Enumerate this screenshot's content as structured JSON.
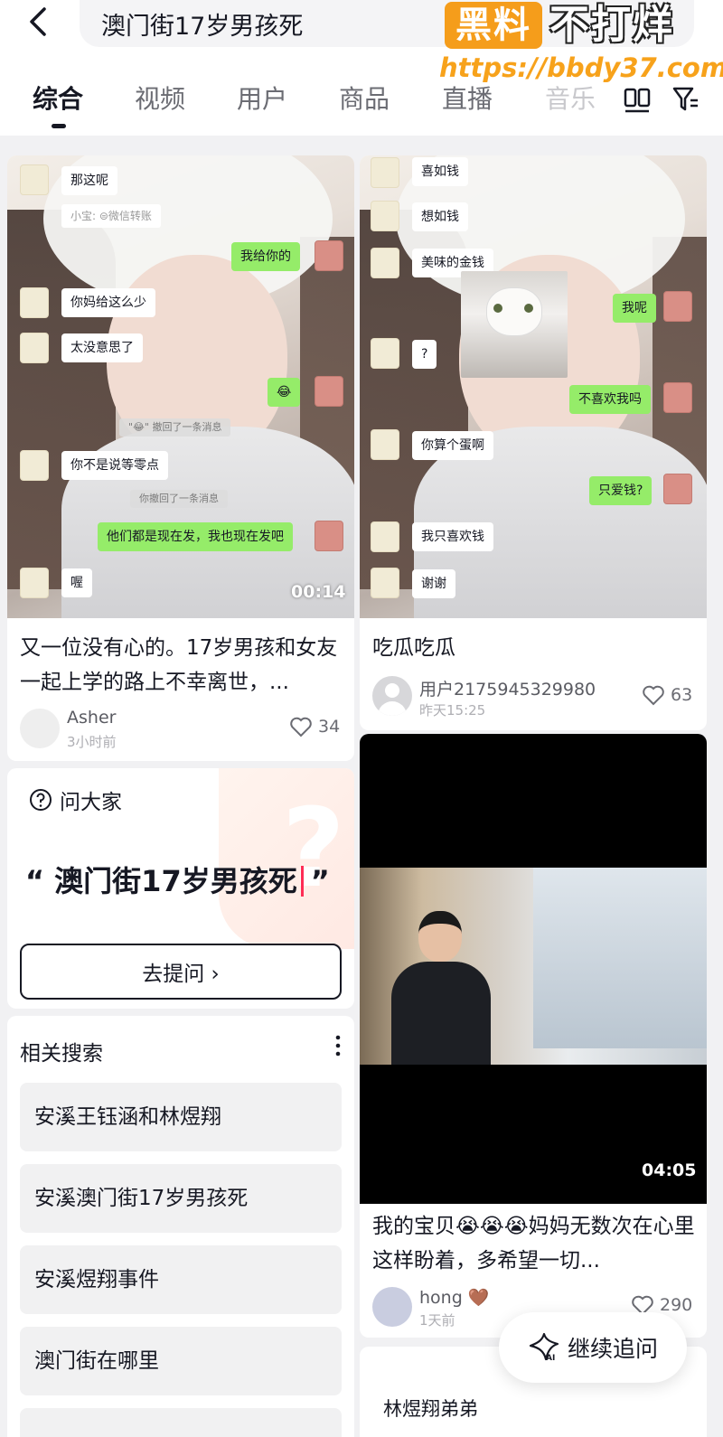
{
  "search": {
    "query": "澳门街17岁男孩死"
  },
  "watermark": {
    "brand_a": "黑料",
    "brand_b": "不打烊",
    "url": "https://bbdy37.com"
  },
  "tabs": [
    {
      "label": "综合"
    },
    {
      "label": "视频"
    },
    {
      "label": "用户"
    },
    {
      "label": "商品"
    },
    {
      "label": "直播"
    },
    {
      "label": "音乐"
    }
  ],
  "cards": {
    "first": {
      "duration": "00:14",
      "chat": {
        "m1": "那这呢",
        "transfer": "小宝: ⊜微信转账",
        "m2": "我给你的",
        "m3": "你妈给这么少",
        "m4": "太没意思了",
        "m5": "😂",
        "sys1": "\"😂\" 撤回了一条消息",
        "m6": "你不是说等零点",
        "sys2": "你撤回了一条消息",
        "m7": "他们都是现在发，我也现在发吧",
        "m8": "喔"
      },
      "title": "又一位没有心的。17岁男孩和女友一起上学的路上不幸离世，...",
      "author": "Asher",
      "time": "3小时前",
      "likes": "34"
    },
    "second": {
      "chat": {
        "m1": "喜如钱",
        "m2": "想如钱",
        "m3": "美味的金钱",
        "m4": "我呢",
        "m5": "?",
        "m6": "不喜欢我吗",
        "m7": "你算个蛋啊",
        "m8": "只爱钱?",
        "m9": "我只喜欢钱",
        "m10": "谢谢"
      },
      "title": "吃瓜吃瓜",
      "author": "用户2175945329980",
      "time": "昨天15:25",
      "likes": "63"
    },
    "third": {
      "duration": "04:05",
      "title": "我的宝贝😭😭😭妈妈无数次在心里这样盼着，多希望一切...",
      "author": "hong",
      "author_badge": "🤎",
      "time": "1天前",
      "likes": "290"
    },
    "fourth": {
      "title": "林煜翔弟弟"
    }
  },
  "ask": {
    "header": "问大家",
    "open_quote": "“",
    "query": "澳门街17岁男孩死",
    "close_quote": "”",
    "button": "去提问 ›"
  },
  "related": {
    "header": "相关搜索",
    "items": [
      "安溪王钰涵和林煜翔",
      "安溪澳门街17岁男孩死",
      "安溪煜翔事件",
      "澳门街在哪里"
    ]
  },
  "follow_up": {
    "label": "继续追问"
  }
}
